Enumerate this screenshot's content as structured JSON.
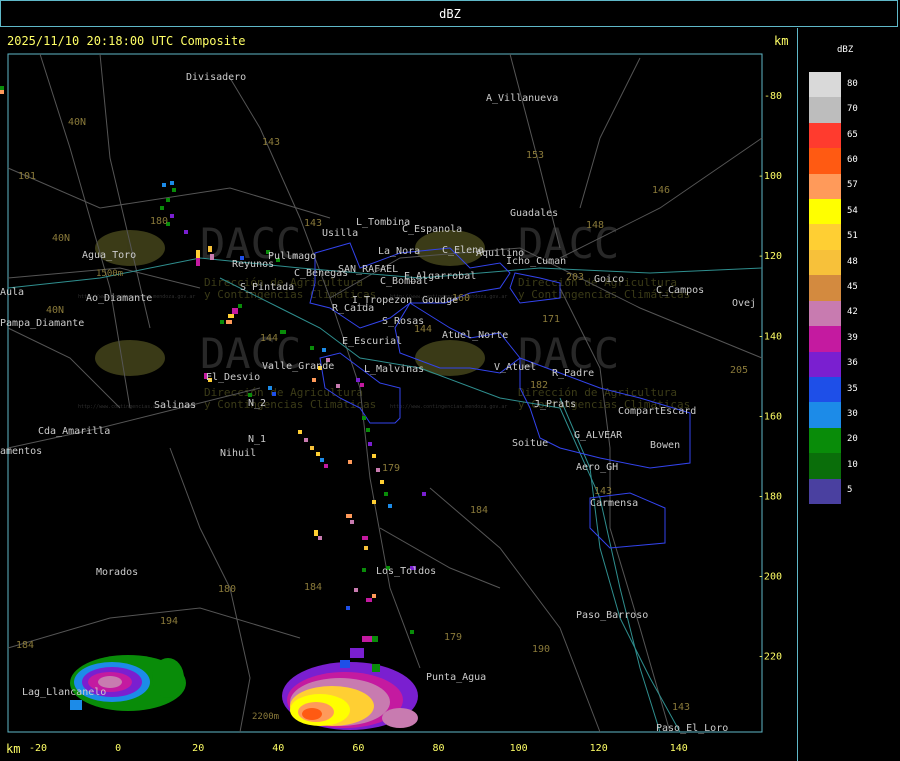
{
  "window": {
    "title": "dBZ"
  },
  "header": {
    "timestamp": "2025/11/10 20:18:00 UTC Composite",
    "km_unit": "km"
  },
  "legend": {
    "title": "dBZ",
    "levels": [
      {
        "label": "80",
        "color": "#d9d9d9"
      },
      {
        "label": "70",
        "color": "#bdbdbd"
      },
      {
        "label": "65",
        "color": "#ff3b2e"
      },
      {
        "label": "60",
        "color": "#ff5a12"
      },
      {
        "label": "57",
        "color": "#ff9a5a"
      },
      {
        "label": "54",
        "color": "#ffff00"
      },
      {
        "label": "51",
        "color": "#ffcf33"
      },
      {
        "label": "48",
        "color": "#f7c13a"
      },
      {
        "label": "45",
        "color": "#d38a3f"
      },
      {
        "label": "42",
        "color": "#c87bb0"
      },
      {
        "label": "39",
        "color": "#c41aa0"
      },
      {
        "label": "36",
        "color": "#7a1fd0"
      },
      {
        "label": "35",
        "color": "#1e4fe8"
      },
      {
        "label": "30",
        "color": "#1c8be8"
      },
      {
        "label": "20",
        "color": "#098c09"
      },
      {
        "label": "10",
        "color": "#0a6e0a"
      },
      {
        "label": "5",
        "color": "#4a40a0"
      }
    ]
  },
  "axes": {
    "x_ticks": [
      "-20",
      "0",
      "20",
      "40",
      "60",
      "80",
      "100",
      "120",
      "140"
    ],
    "y_ticks": [
      "-80",
      "-100",
      "-120",
      "-140",
      "-160",
      "-180",
      "-200",
      "-220"
    ]
  },
  "places": [
    {
      "name": "Divisadero"
    },
    {
      "name": "A_Villanueva"
    },
    {
      "name": "Guadales"
    },
    {
      "name": "L_Tombina"
    },
    {
      "name": "Usilla"
    },
    {
      "name": "C_Espanola"
    },
    {
      "name": "La_Nora"
    },
    {
      "name": "C_Elena"
    },
    {
      "name": "Aquilino"
    },
    {
      "name": "Agua_Toro"
    },
    {
      "name": "Reyunos"
    },
    {
      "name": "Pullmago"
    },
    {
      "name": "SAN_RAFAEL"
    },
    {
      "name": "E_Algarrobal"
    },
    {
      "name": "C_Benegas"
    },
    {
      "name": "C_Bombal"
    },
    {
      "name": "S_Pintada"
    },
    {
      "name": "I_Tropezon"
    },
    {
      "name": "Goudge"
    },
    {
      "name": "R_Caida"
    },
    {
      "name": "S_Rosas"
    },
    {
      "name": "Atuel_Norte"
    },
    {
      "name": "E_Escurial"
    },
    {
      "name": "Valle_Grande"
    },
    {
      "name": "L_Malvinas"
    },
    {
      "name": "V_Atuel"
    },
    {
      "name": "R_Padre"
    },
    {
      "name": "El_Desvio"
    },
    {
      "name": "N_2"
    },
    {
      "name": "Salinas"
    },
    {
      "name": "J_Prats"
    },
    {
      "name": "CompartEscard"
    },
    {
      "name": "Cda_Amarilla"
    },
    {
      "name": "N_1"
    },
    {
      "name": "Nihuil"
    },
    {
      "name": "G_ALVEAR"
    },
    {
      "name": "Bowen"
    },
    {
      "name": "Soitue"
    },
    {
      "name": "Aero_GH"
    },
    {
      "name": "Carmensa"
    },
    {
      "name": "Morados"
    },
    {
      "name": "Pampa_Diamante"
    },
    {
      "name": "Aula"
    },
    {
      "name": "Los_Toldos"
    },
    {
      "name": "Paso_Barroso"
    },
    {
      "name": "Punta_Agua"
    },
    {
      "name": "Lag_Llancanelo"
    },
    {
      "name": "Paso_El_Loro"
    },
    {
      "name": "Goico"
    },
    {
      "name": "C_Campos"
    },
    {
      "name": "Ovej"
    },
    {
      "name": "amentos"
    },
    {
      "name": "Ao_Diamante"
    },
    {
      "name": "Icho_Cuman"
    }
  ],
  "route_numbers": [
    "40N",
    "40N",
    "40N",
    "143",
    "153",
    "146",
    "148",
    "143",
    "203",
    "171",
    "101",
    "144",
    "144",
    "182",
    "179",
    "184",
    "180",
    "184",
    "194",
    "179",
    "190",
    "205",
    "143",
    "184",
    "143",
    "180",
    "160"
  ],
  "watermark": {
    "brand": "DACC",
    "line1": "Dirección de Agricultura",
    "line2": "y Contingencias Climáticas",
    "url": "http://www.contingencias.mendoza.gov.ar",
    "color": "#6b6b2a"
  },
  "elevation_labels": [
    "1500m",
    "2200m"
  ]
}
